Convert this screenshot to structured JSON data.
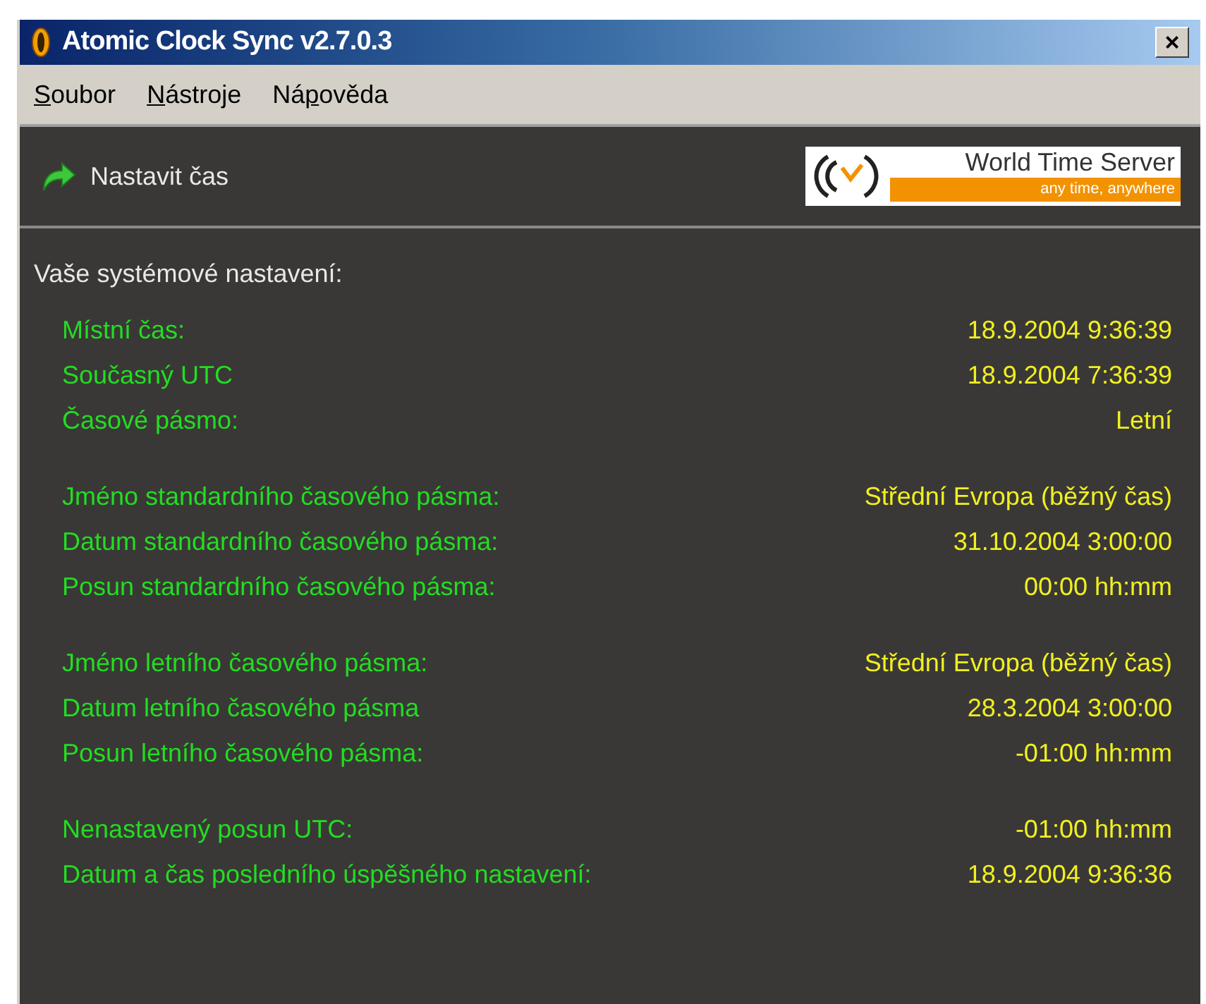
{
  "window": {
    "title": "Atomic Clock Sync v2.7.0.3",
    "close": "×"
  },
  "menu": [
    {
      "key": "S",
      "after": "oubor"
    },
    {
      "key": "N",
      "after": "ástroje"
    },
    {
      "before": "Ná",
      "key": "p",
      "after": "ověda"
    }
  ],
  "toolbar": {
    "action": "Nastavit čas",
    "logo": {
      "title": "World Time Server",
      "slogan": "any time, anywhere"
    }
  },
  "heading": "Vaše systémové nastavení:",
  "groups": [
    {
      "rows": [
        {
          "label": "Místní čas:",
          "value": "18.9.2004 9:36:39"
        },
        {
          "label": "Současný UTC",
          "value": "18.9.2004 7:36:39"
        },
        {
          "label": "Časové pásmo:",
          "value": "Letní"
        }
      ]
    },
    {
      "rows": [
        {
          "label": "Jméno standardního časového pásma:",
          "value": "Střední Evropa (běžný čas)"
        },
        {
          "label": "Datum standardního časového pásma:",
          "value": "31.10.2004 3:00:00"
        },
        {
          "label": "Posun standardního časového pásma:",
          "value": "00:00 hh:mm"
        }
      ]
    },
    {
      "rows": [
        {
          "label": "Jméno letního časového pásma:",
          "value": "Střední Evropa (běžný čas)"
        },
        {
          "label": "Datum letního časového pásma",
          "value": "28.3.2004 3:00:00"
        },
        {
          "label": "Posun letního časového pásma:",
          "value": "-01:00 hh:mm"
        }
      ]
    },
    {
      "rows": [
        {
          "label": "Nenastavený posun UTC:",
          "value": "-01:00 hh:mm"
        },
        {
          "label": "Datum a čas posledního úspěšného nastavení:",
          "value": "18.9.2004 9:36:36"
        }
      ]
    }
  ]
}
